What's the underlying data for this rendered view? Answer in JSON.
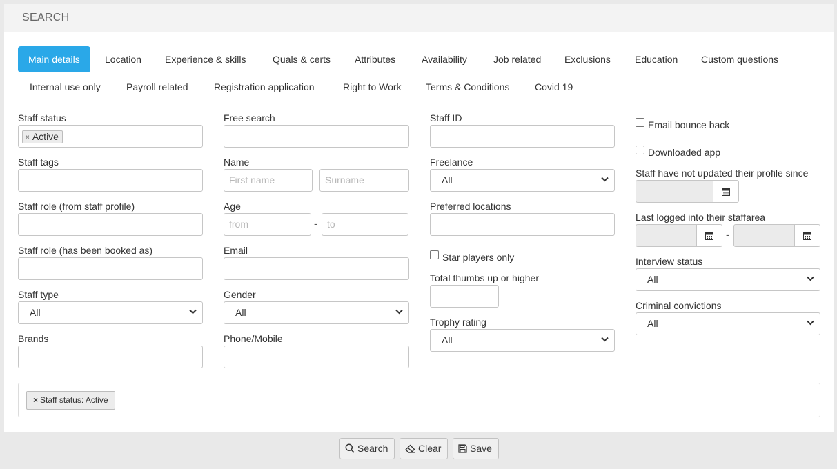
{
  "header": {
    "title": "SEARCH"
  },
  "tabs": [
    "Main details",
    "Location",
    "Experience & skills",
    "Quals & certs",
    "Attributes",
    "Availability",
    "Job related",
    "Exclusions",
    "Education",
    "Custom questions",
    "Internal use only",
    "Payroll related",
    "Registration application",
    "Right to Work",
    "Terms & Conditions",
    "Covid 19"
  ],
  "active_tab": "Main details",
  "form": {
    "staff_status": {
      "label": "Staff status",
      "chip": "Active",
      "chip_remove": "×"
    },
    "staff_tags": {
      "label": "Staff tags",
      "value": ""
    },
    "staff_role_profile": {
      "label": "Staff role (from staff profile)",
      "value": ""
    },
    "staff_role_booked": {
      "label": "Staff role (has been booked as)",
      "value": ""
    },
    "staff_type": {
      "label": "Staff type",
      "value": "All"
    },
    "brands": {
      "label": "Brands",
      "value": ""
    },
    "free_search": {
      "label": "Free search",
      "value": ""
    },
    "name": {
      "label": "Name",
      "first_placeholder": "First name",
      "surname_placeholder": "Surname"
    },
    "age": {
      "label": "Age",
      "from_placeholder": "from",
      "to_placeholder": "to",
      "separator": "-"
    },
    "email": {
      "label": "Email",
      "value": ""
    },
    "gender": {
      "label": "Gender",
      "value": "All"
    },
    "phone": {
      "label": "Phone/Mobile",
      "value": ""
    },
    "staff_id": {
      "label": "Staff ID",
      "value": ""
    },
    "freelance": {
      "label": "Freelance",
      "value": "All"
    },
    "preferred_locations": {
      "label": "Preferred locations",
      "value": ""
    },
    "star_players": {
      "label": "Star players only",
      "checked": false
    },
    "thumbs_up": {
      "label": "Total thumbs up or higher",
      "value": ""
    },
    "trophy_rating": {
      "label": "Trophy rating",
      "value": "All"
    },
    "email_bounce": {
      "label": "Email bounce back",
      "checked": false
    },
    "downloaded_app": {
      "label": "Downloaded app",
      "checked": false
    },
    "not_updated": {
      "label": "Staff have not updated their profile since",
      "value": ""
    },
    "last_logged": {
      "label": "Last logged into their staffarea",
      "from": "",
      "to": "",
      "separator": "-"
    },
    "interview_status": {
      "label": "Interview status",
      "value": "All"
    },
    "criminal_convictions": {
      "label": "Criminal convictions",
      "value": "All"
    }
  },
  "active_filters": [
    {
      "remove": "×",
      "text": "Staff status: Active"
    }
  ],
  "buttons": {
    "search": "Search",
    "clear": "Clear",
    "save": "Save"
  },
  "colors": {
    "accent": "#2aa8e8"
  },
  "icons": {
    "calendar": "calendar-icon",
    "chevron": "chevron-down-icon",
    "search": "search-icon",
    "clear": "eraser-icon",
    "save": "floppy-disk-icon"
  }
}
